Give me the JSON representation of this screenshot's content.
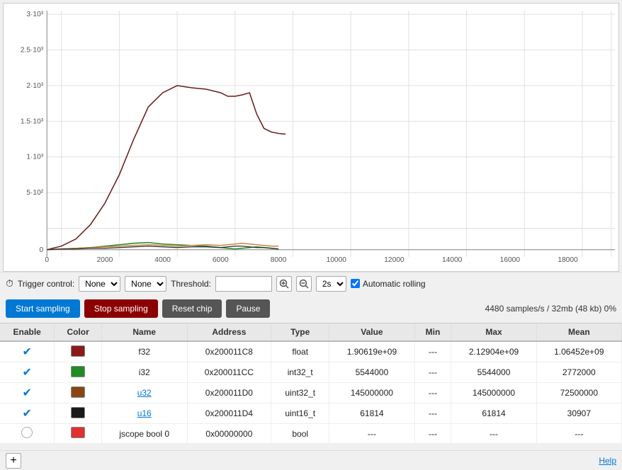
{
  "chart": {
    "yLabels": [
      "3·10³",
      "2.5·10³",
      "2·10³",
      "1.5·10³",
      "1·10³",
      "5·10²",
      "0"
    ],
    "xLabels": [
      "0",
      "2000",
      "4000",
      "6000",
      "8000",
      "10000",
      "12000",
      "14000",
      "16000",
      "18000"
    ]
  },
  "trigger": {
    "label": "Trigger control:",
    "option1": "None",
    "option2": "None",
    "threshold_label": "Threshold:",
    "time_value": "2s",
    "auto_rolling_label": "Automatic rolling"
  },
  "actions": {
    "start": "Start sampling",
    "stop": "Stop sampling",
    "reset": "Reset chip",
    "pause": "Pause",
    "sample_info": "4480 samples/s / 32mb (48 kb) 0%"
  },
  "table": {
    "headers": [
      "Enable",
      "Color",
      "Name",
      "Address",
      "Type",
      "Value",
      "Min",
      "Max",
      "Mean"
    ],
    "rows": [
      {
        "enable": true,
        "color": "#8B1A1A",
        "name": "f32",
        "name_link": false,
        "address": "0x200011C8",
        "type": "float",
        "value": "1.90619e+09",
        "min": "---",
        "max": "2.12904e+09",
        "mean": "1.06452e+09"
      },
      {
        "enable": true,
        "color": "#228B22",
        "name": "i32",
        "name_link": false,
        "address": "0x200011CC",
        "type": "int32_t",
        "value": "5544000",
        "min": "---",
        "max": "5544000",
        "mean": "2772000"
      },
      {
        "enable": true,
        "color": "#8B4513",
        "name": "u32",
        "name_link": true,
        "address": "0x200011D0",
        "type": "uint32_t",
        "value": "145000000",
        "min": "---",
        "max": "145000000",
        "mean": "72500000"
      },
      {
        "enable": true,
        "color": "#1a1a1a",
        "name": "u16",
        "name_link": true,
        "address": "0x200011D4",
        "type": "uint16_t",
        "value": "61814",
        "min": "---",
        "max": "61814",
        "mean": "30907"
      },
      {
        "enable": false,
        "color": "#e03030",
        "name": "jscope bool 0",
        "name_link": false,
        "address": "0x00000000",
        "type": "bool",
        "value": "---",
        "min": "---",
        "max": "---",
        "mean": "---"
      }
    ]
  },
  "footer": {
    "add_label": "+",
    "help_label": "Help"
  }
}
